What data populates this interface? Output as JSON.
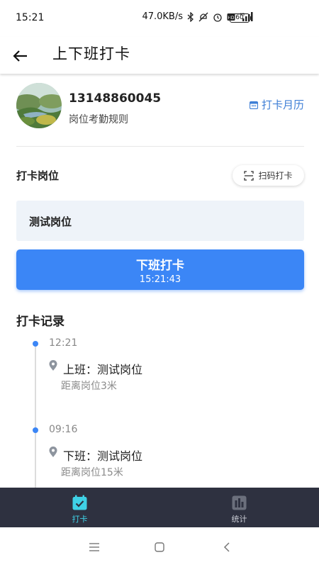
{
  "status_bar": {
    "time": "15:21",
    "network_speed": "47.0KB/s",
    "battery": "60"
  },
  "header": {
    "title": "上下班打卡"
  },
  "profile": {
    "phone": "13148860045",
    "rule_link": "岗位考勤规则",
    "calendar_link": "打卡月历"
  },
  "post_section": {
    "label": "打卡岗位",
    "scan_button": "扫码打卡",
    "selected_post": "测试岗位"
  },
  "punch_button": {
    "label": "下班打卡",
    "time": "15:21:43"
  },
  "records": {
    "title": "打卡记录",
    "items": [
      {
        "time": "12:21",
        "type": "上班：测试岗位",
        "distance": "距离岗位3米"
      },
      {
        "time": "09:16",
        "type": "下班：测试岗位",
        "distance": "距离岗位15米"
      }
    ]
  },
  "tabbar": {
    "tabs": [
      {
        "label": "打卡",
        "active": true
      },
      {
        "label": "统计",
        "active": false
      }
    ]
  },
  "colors": {
    "accent": "#3b86f6",
    "tab_active": "#3fd1e6",
    "tabbar_bg": "#2e3140",
    "link": "#3f7fd6"
  }
}
